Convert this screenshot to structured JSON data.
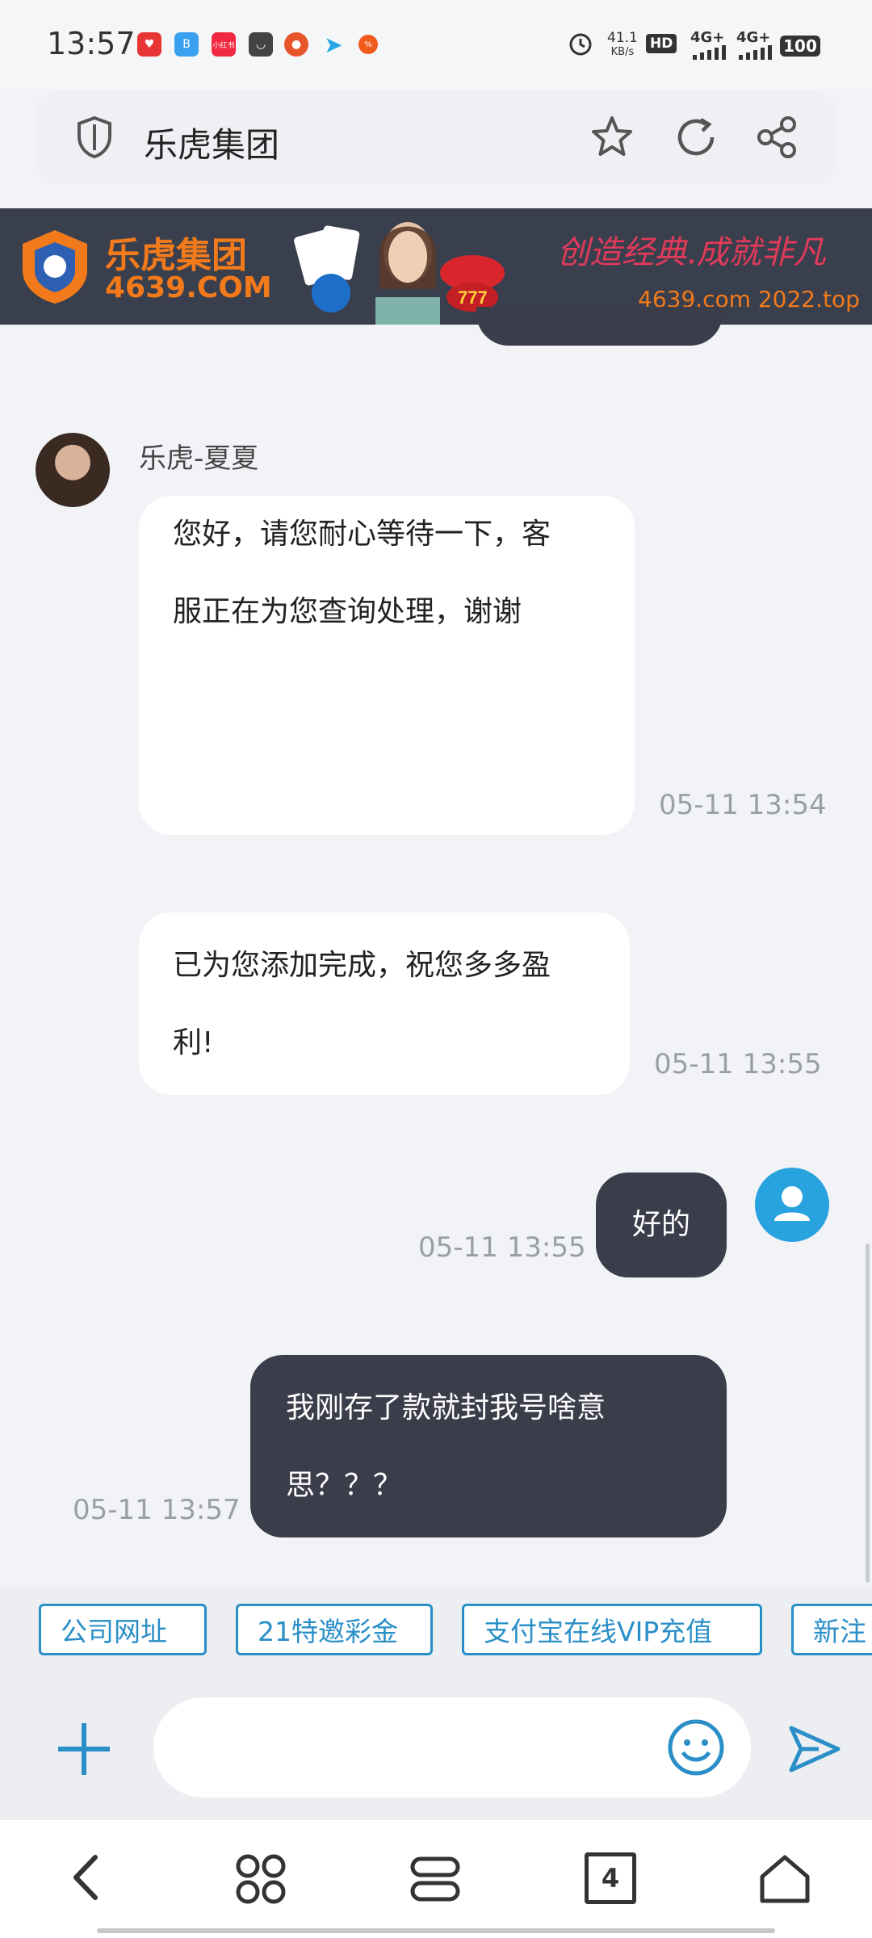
{
  "status_bar": {
    "time": "13:57",
    "net_speed_value": "41.1",
    "net_speed_unit": "KB/s",
    "hd": "HD",
    "sim1": "4G+",
    "sim2": "4G+",
    "battery": "100",
    "app_icons": [
      "app-icon-red",
      "app-icon-blue-b",
      "app-icon-xiaohongshu",
      "app-icon-dark",
      "app-icon-orange",
      "app-icon-telegram",
      "app-icon-orange-dot"
    ]
  },
  "browser": {
    "title": "乐虎集团"
  },
  "banner": {
    "brand_name": "乐虎集团",
    "brand_domain": "4639.COM",
    "slogan": "创造经典.成就非凡",
    "domains": "4639.com 2022.top"
  },
  "chat": {
    "messages": [
      {
        "sender": "乐虎-夏夏",
        "text_line1": "您好，请您耐心等待一下，客",
        "text_line2": "服正在为您查询处理，谢谢",
        "time": "05-11 13:54"
      },
      {
        "text_line1": "已为您添加完成，祝您多多盈",
        "text_line2": "利!",
        "time": "05-11 13:55"
      },
      {
        "text": "好的",
        "time": "05-11 13:55"
      },
      {
        "text_line1": "我刚存了款就封我号啥意",
        "text_line2": "思？？？",
        "time": "05-11 13:57"
      }
    ]
  },
  "quick_replies": [
    "公司网址",
    "21特邀彩金",
    "支付宝在线VIP充值",
    "新注"
  ],
  "input": {
    "placeholder": ""
  },
  "nav": {
    "tab_count": "4"
  },
  "colors": {
    "accent": "#2a8fc7",
    "dark_bubble": "#3b3d4b",
    "banner_orange": "#f27a1a"
  }
}
